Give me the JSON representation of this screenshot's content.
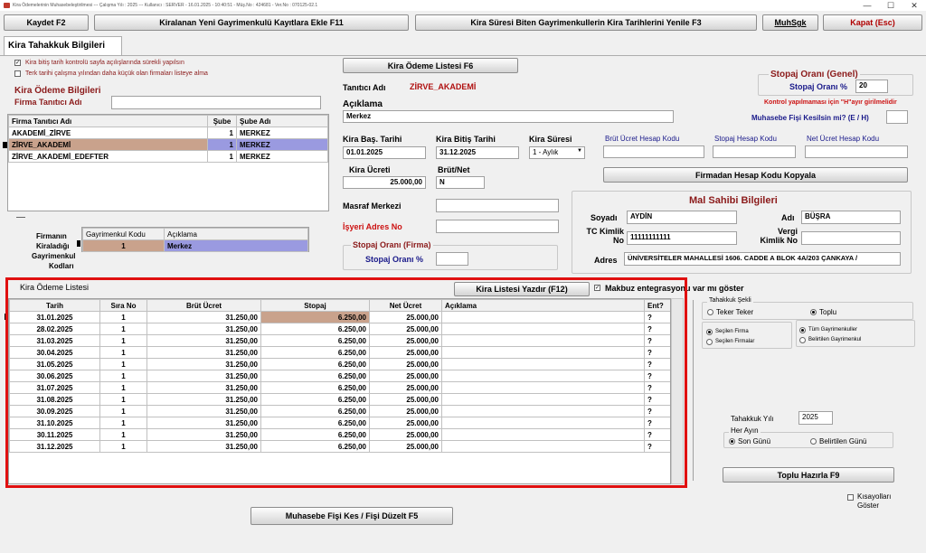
{
  "window": {
    "title": "Kira Ödemelerinin Muhasebeleştirilmesi  ---  Çalışma Yılı : 2025  ---  Kullanıcı : SERVER - 16.01.2025 - 10:40:51 - Müş.No : 424681 - Ver.No : 070125-02.1",
    "min": "—",
    "max": "☐",
    "close": "✕"
  },
  "toolbar": {
    "save": "Kaydet F2",
    "add_new": "Kiralanan Yeni Gayrimenkulü Kayıtlara Ekle F11",
    "renew": "Kira Süresi Biten Gayrimenkullerin Kira Tarihlerini Yenile F3",
    "muhsgk": "MuhSgk",
    "close": "Kapat (Esc)"
  },
  "tab": {
    "label": "Kira Tahakkuk Bilgileri"
  },
  "left": {
    "chk1": "Kira bitiş tarih kontrolü sayfa açılışlarında sürekli yapılsın",
    "chk2": "Terk tarihi çalışma yılından daha küçük olan firmaları listeye alma",
    "section": "Kira Ödeme Bilgileri",
    "firma_label": "Firma Tanıtıcı Adı",
    "firma_value": "",
    "firm_headers": [
      "Firma Tanıtıcı Adı",
      "Şube",
      "Şube Adı"
    ],
    "firms": [
      {
        "name": "AKADEMİ_ZİRVE",
        "branch": "1",
        "branch_name": "MERKEZ"
      },
      {
        "name": "ZİRVE_AKADEMİ",
        "branch": "1",
        "branch_name": "MERKEZ"
      },
      {
        "name": "ZİRVE_AKADEMİ_EDEFTER",
        "branch": "1",
        "branch_name": "MERKEZ"
      }
    ],
    "side_labels": [
      "Firmanın",
      "Kiraladığı",
      "Gayrimenkul",
      "Kodları"
    ],
    "gm_headers": [
      "Gayrimenkul Kodu",
      "Açıklama"
    ],
    "gm_row": {
      "code": "1",
      "desc": "Merkez"
    }
  },
  "center": {
    "list_button": "Kira Ödeme Listesi F6",
    "tanitici_label": "Tanıtıcı Adı",
    "tanitici_value": "ZİRVE_AKADEMİ",
    "aciklama_label": "Açıklama",
    "aciklama_value": "Merkez",
    "bas_label": "Kira Baş. Tarihi",
    "bas_value": "01.01.2025",
    "bitis_label": "Kira Bitiş Tarihi",
    "bitis_value": "31.12.2025",
    "sure_label": "Kira Süresi",
    "sure_value": "1 - Aylık",
    "ucret_label": "Kira Ücreti",
    "ucret_value": "25.000,00",
    "brutnet_label": "Brüt/Net",
    "brutnet_value": "N",
    "masraf_label": "Masraf Merkezi",
    "isyeri_label": "İşyeri Adres No",
    "stopaj_firma_title": "Stopaj Oranı (Firma)",
    "stopaj_firma_label": "Stopaj Oranı %"
  },
  "right": {
    "stopaj_genel_title": "Stopaj Oranı (Genel)",
    "stopaj_genel_label": "Stopaj Oranı %",
    "stopaj_genel_value": "20",
    "kontrol_note": "Kontrol yapılmaması için \"H\"ayır girilmelidir",
    "muh_fisi_label": "Muhasebe Fişi Kesilsin mi? (E / H)",
    "brut_hesap": "Brüt Ücret Hesap Kodu",
    "stopaj_hesap": "Stopaj Hesap Kodu",
    "net_hesap": "Net Ücret Hesap Kodu",
    "kopyala_button": "Firmadan Hesap Kodu Kopyala",
    "owner_title": "Mal Sahibi Bilgileri",
    "soyadi_label": "Soyadı",
    "soyadi_value": "AYDİN",
    "adi_label": "Adı",
    "adi_value": "BÜŞRA",
    "tc_label": "TC Kimlik No",
    "tc_value": "11111111111",
    "vergi_label": "Vergi Kimlik No",
    "vergi_value": "",
    "adres_label": "Adres",
    "adres_value": "ÜNİVERSİTELER MAHALLESİ 1606. CADDE A BLOK 4A/203 ÇANKAYA /"
  },
  "payments": {
    "title": "Kira Ödeme Listesi",
    "print_button": "Kira Listesi Yazdır (F12)",
    "makbuz_label": "Makbuz entegrasyonu var mı göster",
    "headers": [
      "Tarih",
      "Sıra No",
      "Brüt Ücret",
      "Stopaj",
      "Net Ücret",
      "Açıklama",
      "Ent?"
    ],
    "rows": [
      {
        "date": "31.01.2025",
        "no": "1",
        "brut": "31.250,00",
        "stopaj": "6.250,00",
        "net": "25.000,00",
        "desc": "",
        "ent": "?"
      },
      {
        "date": "28.02.2025",
        "no": "1",
        "brut": "31.250,00",
        "stopaj": "6.250,00",
        "net": "25.000,00",
        "desc": "",
        "ent": "?"
      },
      {
        "date": "31.03.2025",
        "no": "1",
        "brut": "31.250,00",
        "stopaj": "6.250,00",
        "net": "25.000,00",
        "desc": "",
        "ent": "?"
      },
      {
        "date": "30.04.2025",
        "no": "1",
        "brut": "31.250,00",
        "stopaj": "6.250,00",
        "net": "25.000,00",
        "desc": "",
        "ent": "?"
      },
      {
        "date": "31.05.2025",
        "no": "1",
        "brut": "31.250,00",
        "stopaj": "6.250,00",
        "net": "25.000,00",
        "desc": "",
        "ent": "?"
      },
      {
        "date": "30.06.2025",
        "no": "1",
        "brut": "31.250,00",
        "stopaj": "6.250,00",
        "net": "25.000,00",
        "desc": "",
        "ent": "?"
      },
      {
        "date": "31.07.2025",
        "no": "1",
        "brut": "31.250,00",
        "stopaj": "6.250,00",
        "net": "25.000,00",
        "desc": "",
        "ent": "?"
      },
      {
        "date": "31.08.2025",
        "no": "1",
        "brut": "31.250,00",
        "stopaj": "6.250,00",
        "net": "25.000,00",
        "desc": "",
        "ent": "?"
      },
      {
        "date": "30.09.2025",
        "no": "1",
        "brut": "31.250,00",
        "stopaj": "6.250,00",
        "net": "25.000,00",
        "desc": "",
        "ent": "?"
      },
      {
        "date": "31.10.2025",
        "no": "1",
        "brut": "31.250,00",
        "stopaj": "6.250,00",
        "net": "25.000,00",
        "desc": "",
        "ent": "?"
      },
      {
        "date": "30.11.2025",
        "no": "1",
        "brut": "31.250,00",
        "stopaj": "6.250,00",
        "net": "25.000,00",
        "desc": "",
        "ent": "?"
      },
      {
        "date": "31.12.2025",
        "no": "1",
        "brut": "31.250,00",
        "stopaj": "6.250,00",
        "net": "25.000,00",
        "desc": "",
        "ent": "?"
      }
    ]
  },
  "tahakkuk": {
    "sekli_title": "Tahakkuk Şekli",
    "teker": "Teker Teker",
    "toplu": "Toplu",
    "secilen_firma": "Seçilen Firma",
    "secilen_firmalar": "Seçilen Firmalar",
    "tum_gm": "Tüm Gayrimenkuller",
    "belirtilen_gm": "Belirtilen Gayrimenkul",
    "yil_label": "Tahakkuk Yılı",
    "yil_value": "2025",
    "her_ayin": "Her Ayın",
    "son_gunu": "Son Günü",
    "belirtilen_gun": "Belirtilen Günü",
    "hazirla_button": "Toplu Hazırla F9",
    "kisayol": "Kısayolları Göster"
  },
  "bottom": {
    "muh_button": "Muhasebe Fişi Kes / Fişi Düzelt F5"
  },
  "colors": {
    "selected_row": "#c9a28c",
    "selected_blue": "#9a9ae0",
    "highlight_box": "#e01010",
    "title_red": "#cc1111"
  }
}
